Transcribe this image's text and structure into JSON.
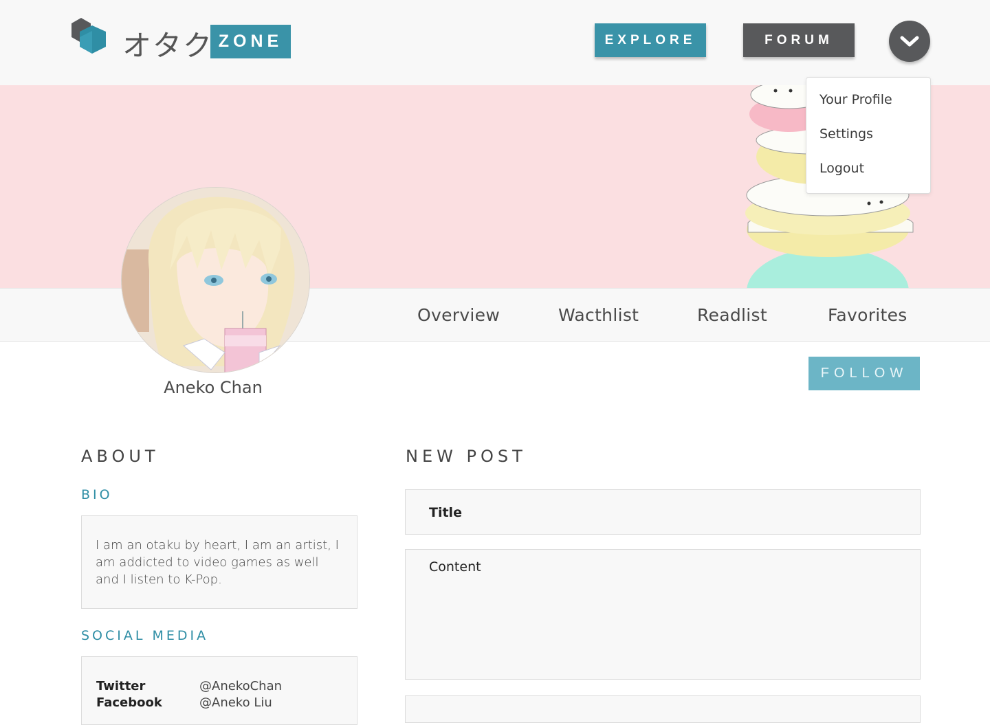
{
  "header": {
    "logo_kana": "オタク",
    "logo_badge": "ZONE",
    "nav": {
      "explore": "EXPLORE",
      "forum": "FORUM"
    },
    "menu_icon": "chevron-down-icon"
  },
  "dropdown": {
    "items": [
      "Your Profile",
      "Settings",
      "Logout"
    ]
  },
  "profile": {
    "name": "Aneko Chan",
    "tabs": [
      "Overview",
      "Wacthlist",
      "Readlist",
      "Favorites"
    ],
    "follow_label": "FOLLOW"
  },
  "about": {
    "title": "ABOUT",
    "bio_label": "BIO",
    "bio_text": "I am an otaku by heart, I am an artist, I am addicted to video games as well and I listen to K-Pop.",
    "social_label": "SOCIAL MEDIA",
    "social": [
      {
        "platform": "Twitter",
        "handle": "@AnekoChan"
      },
      {
        "platform": "Facebook",
        "handle": "@Aneko Liu"
      }
    ]
  },
  "new_post": {
    "title": "NEW POST",
    "title_placeholder": "Title",
    "content_placeholder": "Content"
  },
  "colors": {
    "accent": "#3a93a8",
    "dark": "#58595b",
    "banner": "#fbdfe1",
    "follow": "#6cb5c6"
  }
}
